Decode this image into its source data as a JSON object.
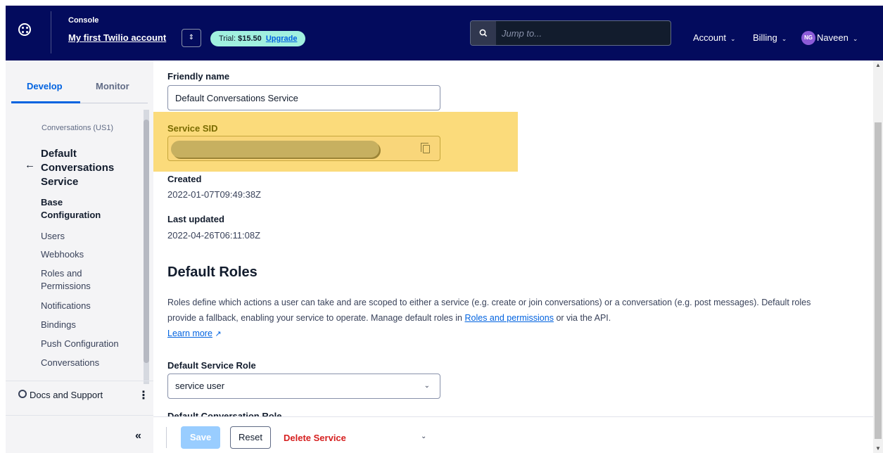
{
  "topbar": {
    "console_label": "Console",
    "account_name": "My first Twilio account",
    "trial_prefix": "Trial:",
    "trial_amount": "$15.50",
    "upgrade_label": "Upgrade",
    "search_placeholder": "Jump to...",
    "account_menu": "Account",
    "billing_menu": "Billing",
    "user_initials": "NG",
    "user_name": "Naveen"
  },
  "sidebar": {
    "tabs": [
      {
        "label": "Develop",
        "active": true
      },
      {
        "label": "Monitor",
        "active": false
      }
    ],
    "breadcrumb": "Conversations (US1)",
    "service_title_lines": [
      "Default",
      "Conversations",
      "Service"
    ],
    "items": [
      {
        "label": "Base Configuration",
        "active": true
      },
      {
        "label": "Users"
      },
      {
        "label": "Webhooks"
      },
      {
        "label": "Roles and Permissions"
      },
      {
        "label": "Notifications"
      },
      {
        "label": "Bindings"
      },
      {
        "label": "Push Configuration"
      },
      {
        "label": "Conversations"
      }
    ],
    "docs_label": "Docs and Support"
  },
  "main": {
    "friendly_name_label": "Friendly name",
    "friendly_name_value": "Default Conversations Service",
    "service_sid_label": "Service SID",
    "created_label": "Created",
    "created_value": "2022-01-07T09:49:38Z",
    "updated_label": "Last updated",
    "updated_value": "2022-04-26T06:11:08Z",
    "roles_heading": "Default Roles",
    "roles_text_1": "Roles define which actions a user can take and are scoped to either a service (e.g. create or join conversations) or a conversation (e.g. post messages). Default roles provide a fallback, enabling your service to operate. Manage default roles in",
    "roles_link": "Roles and permissions",
    "roles_text_2": "or via the API.",
    "learn_more": "Learn more",
    "service_role_label": "Default Service Role",
    "service_role_value": "service user",
    "conversation_role_label": "Default Conversation Role"
  },
  "actions": {
    "save": "Save",
    "reset": "Reset",
    "delete": "Delete Service"
  },
  "colors": {
    "header_bg": "#030b5d",
    "accent": "#0263e0",
    "highlight": "#fbdb7b",
    "danger": "#d61f1f"
  }
}
